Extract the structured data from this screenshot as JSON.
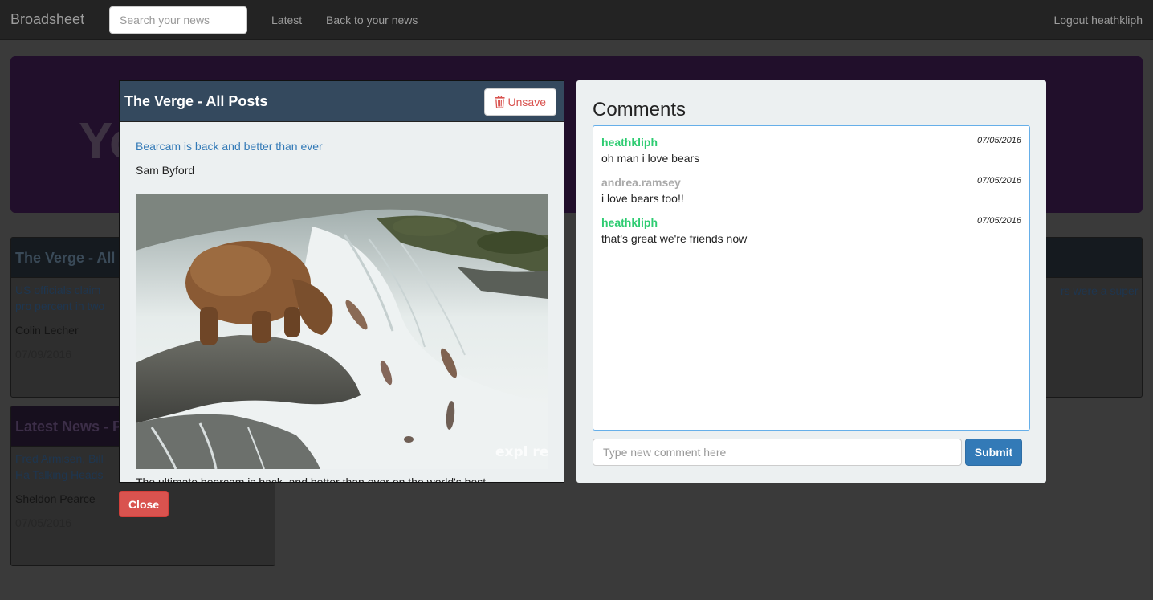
{
  "navbar": {
    "brand": "Broadsheet",
    "search_placeholder": "Search your news",
    "latest_label": "Latest",
    "back_label": "Back to your news",
    "logout_label": "Logout heathkliph"
  },
  "background": {
    "jumbotron_text": "Yo",
    "cards": [
      {
        "header": "The Verge - All P",
        "link": "US officials claim pro percent in two years",
        "author": "Colin Lecher",
        "date": "07/09/2016"
      },
      {
        "header": "Latest News - Po",
        "link": "Fred Armisen, Bill Ha Talking Heads <i>Sto",
        "author": "Sheldon Pearce",
        "date": "07/05/2016"
      }
    ],
    "right_card_text": "rs were a super-"
  },
  "article": {
    "source": "The Verge - All Posts",
    "unsave_label": "Unsave",
    "title": "Bearcam is back and better than ever",
    "author": "Sam Byford",
    "image_watermark": "expl re",
    "snippet": "The ultimate bearcam is back, and better than ever on the world's best"
  },
  "close_label": "Close",
  "comments": {
    "title": "Comments",
    "items": [
      {
        "user": "heathkliph",
        "date": "07/05/2016",
        "text": "oh man i love bears"
      },
      {
        "user": "andrea.ramsey",
        "date": "07/05/2016",
        "text": "i love bears too!!"
      },
      {
        "user": "heathkliph",
        "date": "07/05/2016",
        "text": "that's great we're friends now"
      }
    ],
    "input_placeholder": "Type new comment here",
    "submit_label": "Submit"
  },
  "colors": {
    "navbar": "#232323",
    "article_header": "#34495e",
    "current_user": "#2ecc71",
    "other_user": "#aaaaaa",
    "danger": "#d9534f",
    "primary": "#337ab7"
  }
}
